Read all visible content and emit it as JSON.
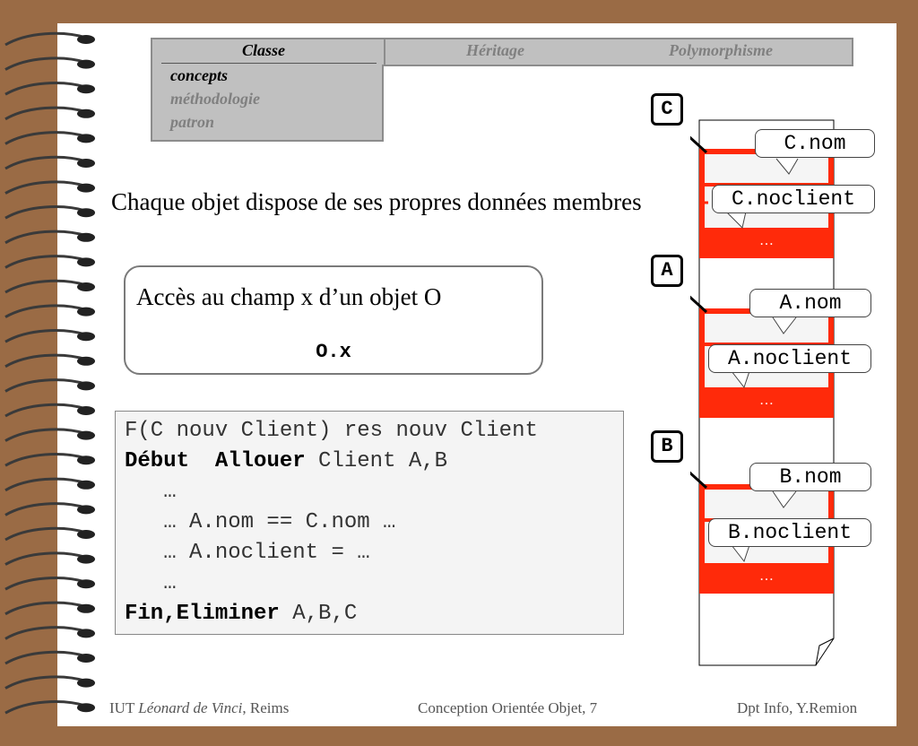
{
  "nav": {
    "tabs": [
      "Classe",
      "Héritage",
      "Polymorphisme"
    ],
    "sub_items": [
      "concepts",
      "méthodologie",
      "patron"
    ]
  },
  "main_text": "Chaque objet dispose de ses propres données membres",
  "access_box": {
    "title": "Accès au champ x d’un objet O",
    "code": "O.x"
  },
  "code": {
    "line1": "F(C nouv Client) res nouv Client",
    "debut": "Début",
    "allouer": "Allouer",
    "line2_rest": " Client A,B",
    "line3": "   …",
    "line4": "   … A.nom == C.nom …",
    "line5": "   … A.noclient = …",
    "line6": "   …",
    "fin": "Fin,Eliminer",
    "line7_rest": " A,B,C"
  },
  "memory": {
    "objects": [
      {
        "label": "C",
        "nom": "C.nom",
        "noclient": "C.noclient",
        "more": "…"
      },
      {
        "label": "A",
        "nom": "A.nom",
        "noclient": "A.noclient",
        "more": "…"
      },
      {
        "label": "B",
        "nom": "B.nom",
        "noclient": "B.noclient",
        "more": "…"
      }
    ]
  },
  "footer": {
    "left_prefix": "IUT ",
    "left_italic": "Léonard de Vinci",
    "left_suffix": ", Reims",
    "center": "Conception Orientée Objet, 7",
    "right": "Dpt Info, Y.Remion"
  },
  "colors": {
    "background": "#9a6b45",
    "nav": "#c0c0c0",
    "object_fill": "#ff2a0a",
    "nav_active": "#000000",
    "nav_inactive": "#808080"
  }
}
